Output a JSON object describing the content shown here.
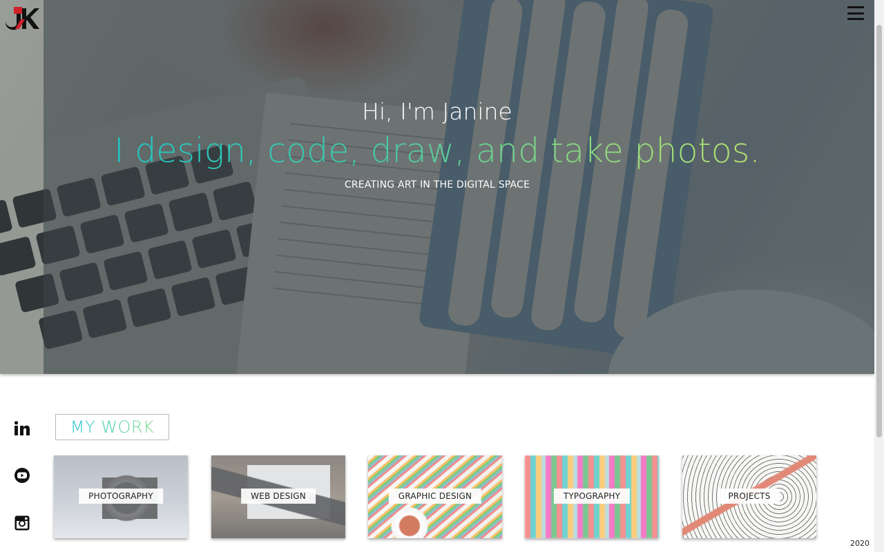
{
  "header": {
    "logo_name": "JK logo",
    "menu_icon": "hamburger-menu-icon"
  },
  "hero": {
    "greeting": "Hi, I'm Janine",
    "tagline": "I design, code, draw, and take photos.",
    "subline": "CREATING ART IN THE DIGITAL SPACE",
    "tagline_gradient": [
      "#17c7cf",
      "#3fc9a6",
      "#8ed97e",
      "#c5e46a"
    ]
  },
  "social": [
    {
      "icon": "linkedin-icon"
    },
    {
      "icon": "youtube-icon"
    },
    {
      "icon": "instagram-icon"
    }
  ],
  "work": {
    "heading": "MY WORK",
    "cards": [
      {
        "label": "PHOTOGRAPHY"
      },
      {
        "label": "WEB DESIGN"
      },
      {
        "label": "GRAPHIC DESIGN"
      },
      {
        "label": "TYPOGRAPHY"
      },
      {
        "label": "PROJECTS"
      }
    ]
  },
  "footer": {
    "year": "2020"
  },
  "colors": {
    "accent_teal": "#17c7cf",
    "accent_green": "#8ed97e",
    "logo_red": "#d0202a"
  }
}
